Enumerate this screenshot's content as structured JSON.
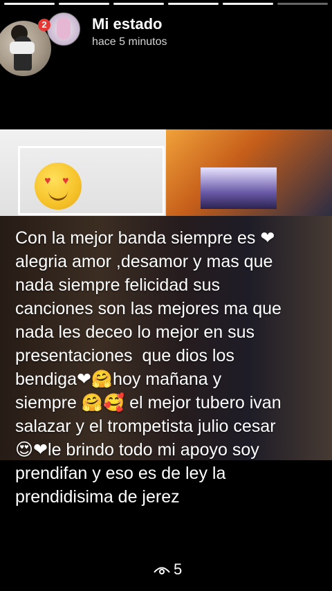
{
  "header": {
    "title": "Mi estado",
    "timestamp": "hace 5 minutos",
    "badge_count": "2",
    "progress_segments": 6
  },
  "story": {
    "caption": "Con la mejor banda siempre es ❤\nalegria amor ,desamor y mas que\nnada siempre felicidad sus\ncanciones son las mejores ma que\nnada les deceo lo mejor en sus\npresentaciones  que dios los\nbendiga❤🤗hoy mañana y\nsiempre 🤗🥰 el mejor tubero ivan\nsalazar y el trompetista julio cesar\n😍❤le brindo todo mi apoyo soy\nprendifan y eso es de ley la\nprendidisima de jerez"
  },
  "footer": {
    "views_icon": "eye-icon",
    "views_count": "5"
  }
}
